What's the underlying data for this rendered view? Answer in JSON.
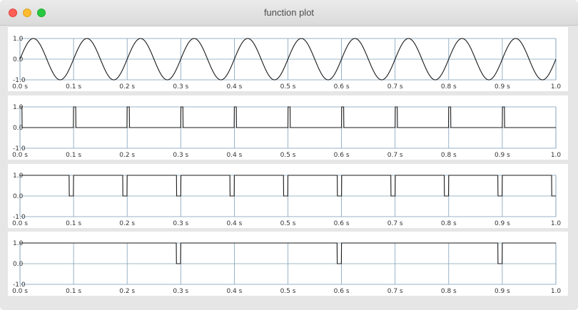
{
  "window": {
    "title": "function plot"
  },
  "colors": {
    "grid": "#7fa0b9",
    "curve": "#1a1a1a",
    "panel": "#ffffff",
    "background": "#e6e6e6"
  },
  "chart_data": [
    {
      "type": "line",
      "function": "sine",
      "frequency_hz": 10,
      "x_tick_labels": [
        "0.0 s",
        "0.1 s",
        "0.2 s",
        "0.3 s",
        "0.4 s",
        "0.5 s",
        "0.6 s",
        "0.7 s",
        "0.8 s",
        "0.9 s",
        "1.0"
      ],
      "y_tick_labels": [
        "1.0",
        "0.0",
        "-1.0"
      ],
      "xlim": [
        0,
        1
      ],
      "ylim": [
        -1,
        1
      ],
      "grid": true
    },
    {
      "type": "line",
      "function": "pulse_train",
      "period_s": 0.1,
      "pulse_width_s": 0.004,
      "pulse_phase_s": 0.0,
      "baseline": 0,
      "pulse_level": 1,
      "x_tick_labels": [
        "0.0 s",
        "0.1 s",
        "0.2 s",
        "0.3 s",
        "0.4 s",
        "0.5 s",
        "0.6 s",
        "0.7 s",
        "0.8 s",
        "0.9 s",
        "1.0"
      ],
      "y_tick_labels": [
        "1.0",
        "0.0",
        "-1.0"
      ],
      "xlim": [
        0,
        1
      ],
      "ylim": [
        -1,
        1
      ],
      "grid": true
    },
    {
      "type": "line",
      "function": "notch_train",
      "period_s": 0.1,
      "notch_width_s": 0.008,
      "notch_phase_s": 0.092,
      "baseline": 1,
      "notch_level": 0,
      "x_tick_labels": [
        "0.0 s",
        "0.1 s",
        "0.2 s",
        "0.3 s",
        "0.4 s",
        "0.5 s",
        "0.6 s",
        "0.7 s",
        "0.8 s",
        "0.9 s",
        "1.0"
      ],
      "y_tick_labels": [
        "1.0",
        "0.0",
        "-1.0"
      ],
      "xlim": [
        0,
        1
      ],
      "ylim": [
        -1,
        1
      ],
      "grid": true
    },
    {
      "type": "line",
      "function": "notch_train",
      "period_s": 0.3,
      "notch_width_s": 0.008,
      "notch_phase_s": 0.292,
      "baseline": 1,
      "notch_level": 0,
      "x_tick_labels": [
        "0.0 s",
        "0.1 s",
        "0.2 s",
        "0.3 s",
        "0.4 s",
        "0.5 s",
        "0.6 s",
        "0.7 s",
        "0.8 s",
        "0.9 s",
        "1.0"
      ],
      "y_tick_labels": [
        "1.0",
        "0.0",
        "-1.0"
      ],
      "xlim": [
        0,
        1
      ],
      "ylim": [
        -1,
        1
      ],
      "grid": true
    }
  ]
}
